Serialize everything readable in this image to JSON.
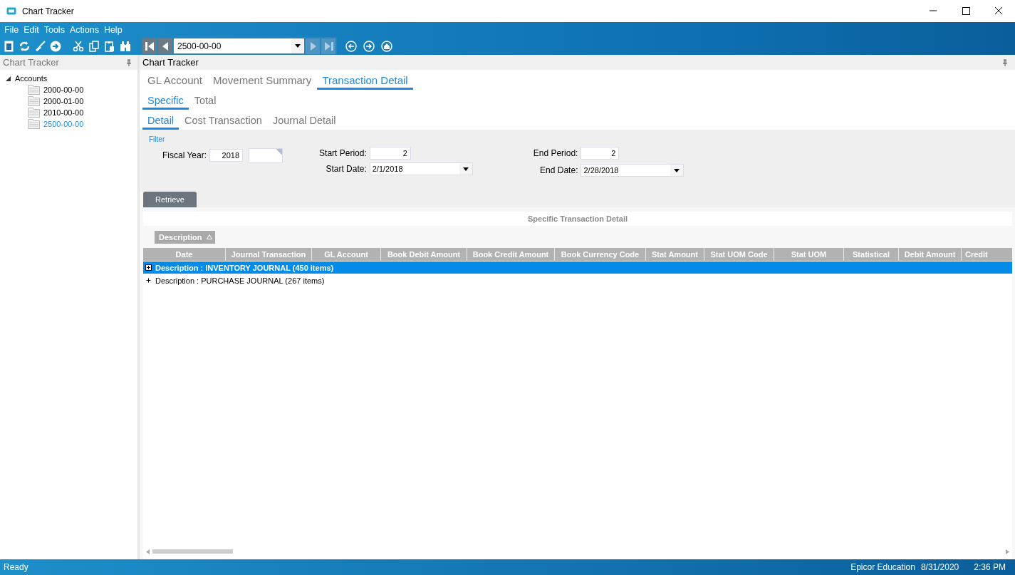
{
  "window": {
    "title": "Chart Tracker"
  },
  "menu": [
    "File",
    "Edit",
    "Tools",
    "Actions",
    "Help"
  ],
  "toolbar": {
    "record": "2500-00-00",
    "nav": [
      {
        "kind": "first",
        "disabled": false
      },
      {
        "kind": "prev",
        "disabled": false
      },
      {
        "kind": "next",
        "disabled": true
      },
      {
        "kind": "last",
        "disabled": true
      }
    ]
  },
  "tree": {
    "title": "Chart Tracker",
    "items": [
      {
        "label": "Accounts",
        "expanded": true,
        "children": [
          {
            "label": "2000-00-00",
            "selected": false
          },
          {
            "label": "2000-01-00",
            "selected": false
          },
          {
            "label": "2010-00-00",
            "selected": false
          },
          {
            "label": "2500-00-00",
            "selected": true
          }
        ]
      }
    ]
  },
  "panel": {
    "title": "Chart Tracker"
  },
  "tabs": [
    {
      "label": "GL Account",
      "selected": false
    },
    {
      "label": "Movement Summary",
      "selected": false
    },
    {
      "label": "Transaction Detail",
      "selected": true
    }
  ],
  "subtabs": [
    {
      "label": "Specific",
      "selected": true
    },
    {
      "label": "Total",
      "selected": false
    }
  ],
  "detail_tabs": [
    {
      "label": "Detail",
      "selected": true
    },
    {
      "label": "Cost Transaction",
      "selected": false
    },
    {
      "label": "Journal Detail",
      "selected": false
    }
  ],
  "filter": {
    "title": "Filter",
    "fiscal_year": {
      "label": "Fiscal Year:",
      "value": "2018"
    },
    "start_period": {
      "label": "Start Period:",
      "value": "2"
    },
    "start_date": {
      "label": "Start Date:",
      "value": "2/1/2018"
    },
    "end_period": {
      "label": "End Period:",
      "value": "2"
    },
    "end_date": {
      "label": "End Date:",
      "value": "2/28/2018"
    }
  },
  "retrieve": "Retrieve",
  "grid": {
    "title": "Specific Transaction Detail",
    "group_by": "Description",
    "columns": [
      "Date",
      "Journal Transaction",
      "GL Account",
      "Book Debit Amount",
      "Book Credit Amount",
      "Book Currency Code",
      "Stat Amount",
      "Stat UOM Code",
      "Stat UOM",
      "Statistical",
      "Debit Amount",
      "Credit"
    ],
    "groups": [
      {
        "label": "Description : INVENTORY JOURNAL (450 items)",
        "selected": true
      },
      {
        "label": "Description : PURCHASE JOURNAL (267 items)",
        "selected": false
      }
    ]
  },
  "status_bar": {
    "status": "Ready",
    "company": "Epicor Education",
    "date": "8/31/2020",
    "time": "2:36 PM"
  }
}
